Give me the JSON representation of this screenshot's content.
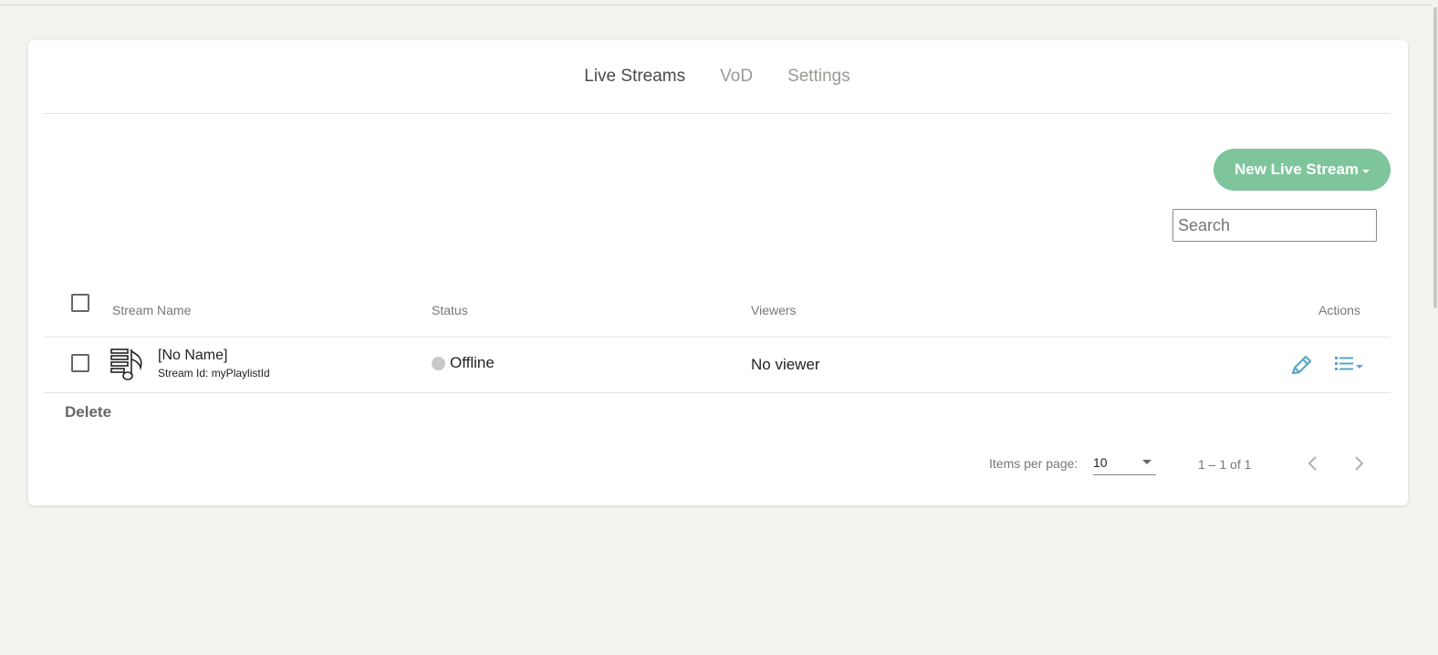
{
  "tabs": [
    {
      "label": "Live Streams",
      "active": true
    },
    {
      "label": "VoD",
      "active": false
    },
    {
      "label": "Settings",
      "active": false
    }
  ],
  "toolbar": {
    "new_stream_label": "New Live Stream",
    "search_placeholder": "Search"
  },
  "table": {
    "headers": {
      "name": "Stream Name",
      "status": "Status",
      "viewers": "Viewers",
      "actions": "Actions"
    },
    "rows": [
      {
        "name": "[No Name]",
        "stream_id": "Stream Id: myPlaylistId",
        "status": "Offline",
        "status_color": "#c8c8c8",
        "viewers": "No viewer"
      }
    ]
  },
  "bulk": {
    "delete_label": "Delete"
  },
  "pagination": {
    "items_per_page_label": "Items per page:",
    "items_per_page_value": "10",
    "range_label": "1 – 1 of 1"
  },
  "colors": {
    "accent": "#7ec59c",
    "action_icon": "#5aa6c8",
    "background": "#f3f2ef"
  }
}
